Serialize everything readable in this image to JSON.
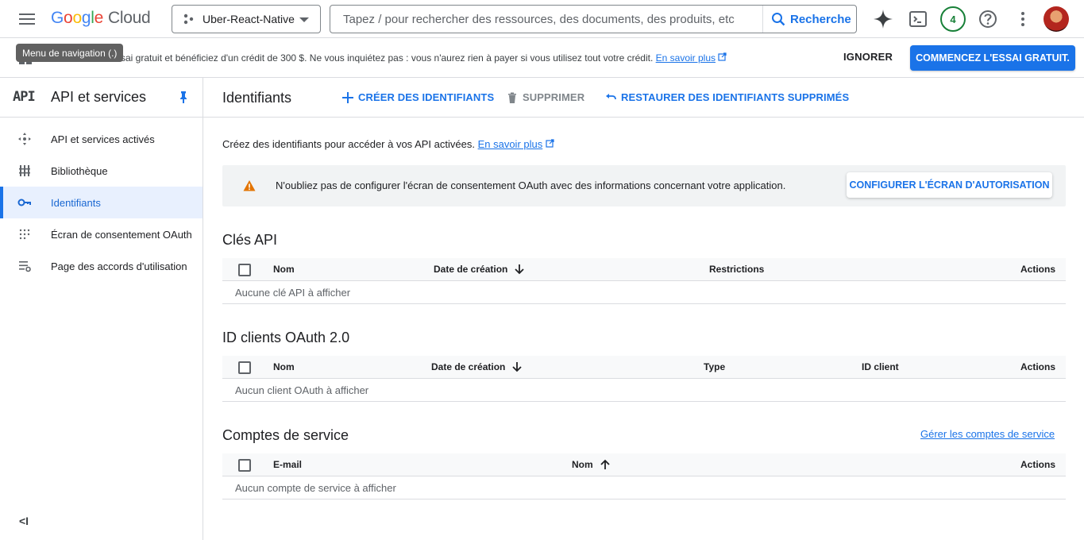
{
  "topbar": {
    "logo_google": [
      "G",
      "o",
      "o",
      "g",
      "l",
      "e"
    ],
    "logo_cloud": "Cloud",
    "project_name": "Uber-React-Native",
    "search_placeholder": "Tapez / pour rechercher des ressources, des documents, des produits, etc",
    "search_button": "Recherche",
    "notifications_count": "4"
  },
  "tooltip": "Menu de navigation (.)",
  "banner": {
    "text": "ssai gratuit et bénéficiez d'un crédit de 300 $. Ne vous inquiétez pas : vous n'aurez rien à payer si vous utilisez tout votre crédit.",
    "link": "En savoir plus",
    "ignore": "IGNORER",
    "cta": "COMMENCEZ L'ESSAI GRATUIT."
  },
  "sidebar": {
    "api_mark": "API",
    "title": "API et services",
    "items": [
      {
        "label": "API et services activés",
        "icon": "services-icon"
      },
      {
        "label": "Bibliothèque",
        "icon": "library-icon"
      },
      {
        "label": "Identifiants",
        "icon": "key-icon",
        "active": true
      },
      {
        "label": "Écran de consentement OAuth",
        "icon": "consent-icon"
      },
      {
        "label": "Page des accords d'utilisation",
        "icon": "agreements-icon"
      }
    ]
  },
  "page": {
    "title": "Identifiants",
    "actions": {
      "create": "CRÉER DES IDENTIFIANTS",
      "delete": "SUPPRIMER",
      "restore": "RESTAURER DES IDENTIFIANTS SUPPRIMÉS"
    },
    "intro": "Créez des identifiants pour accéder à vos API activées.",
    "intro_link": "En savoir plus",
    "warning": {
      "text": "N'oubliez pas de configurer l'écran de consentement OAuth avec des informations concernant votre application.",
      "button": "CONFIGURER L'ÉCRAN D'AUTORISATION"
    }
  },
  "api_keys": {
    "title": "Clés API",
    "columns": [
      "Nom",
      "Date de création",
      "Restrictions",
      "Actions"
    ],
    "empty": "Aucune clé API à afficher"
  },
  "oauth_clients": {
    "title": "ID clients OAuth 2.0",
    "columns": [
      "Nom",
      "Date de création",
      "Type",
      "ID client",
      "Actions"
    ],
    "empty": "Aucun client OAuth à afficher"
  },
  "service_accounts": {
    "title": "Comptes de service",
    "manage_link": "Gérer les comptes de service",
    "columns": [
      "E-mail",
      "Nom",
      "Actions"
    ],
    "empty": "Aucun compte de service à afficher"
  },
  "colors": {
    "primary": "#1a73e8",
    "active_bg": "#e8f0fe",
    "warning": "#e37400",
    "border": "#dadce0"
  }
}
